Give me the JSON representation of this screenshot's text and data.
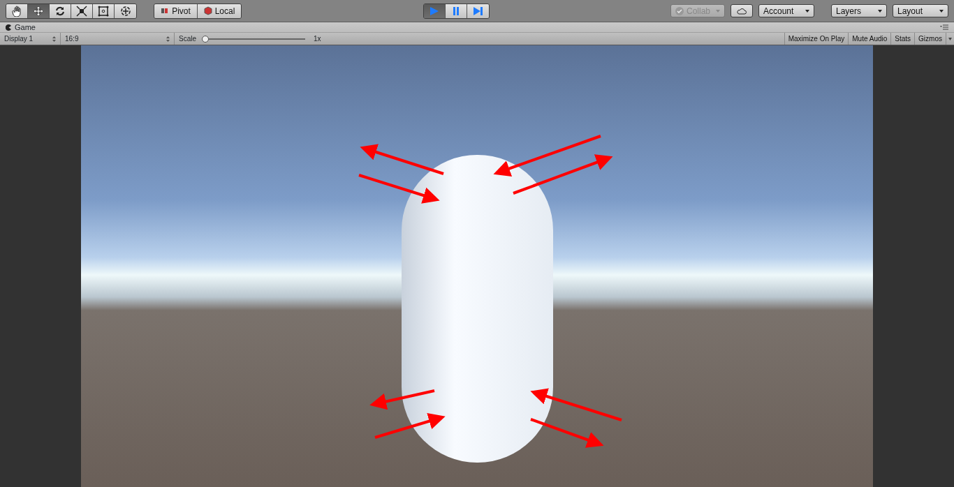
{
  "toolbar": {
    "tools": [
      {
        "kind": "hand",
        "selected": false
      },
      {
        "kind": "move",
        "selected": true
      },
      {
        "kind": "rotate",
        "selected": false
      },
      {
        "kind": "scale",
        "selected": false
      },
      {
        "kind": "rect",
        "selected": false
      },
      {
        "kind": "transform",
        "selected": false
      }
    ],
    "handles": [
      {
        "kind": "pivot",
        "label": "Pivot"
      },
      {
        "kind": "local",
        "label": "Local"
      }
    ],
    "playback": [
      {
        "kind": "play",
        "selected": true
      },
      {
        "kind": "pause",
        "selected": false
      },
      {
        "kind": "step",
        "selected": false
      }
    ],
    "collab": {
      "label": "Collab",
      "disabled": true
    },
    "account": {
      "label": "Account"
    },
    "layers": {
      "label": "Layers"
    },
    "layout": {
      "label": "Layout"
    }
  },
  "game_tab": {
    "title": "Game"
  },
  "game_toolbar": {
    "display": "Display 1",
    "aspect": "16:9",
    "scale_label": "Scale",
    "scale": {
      "level": 0
    },
    "scale_reading": "1x",
    "toggles": [
      {
        "label": "Maximize On Play",
        "on": false
      },
      {
        "label": "Mute Audio",
        "on": false
      },
      {
        "label": "Stats",
        "on": false
      },
      {
        "label": "Gizmos",
        "on": false
      }
    ]
  }
}
